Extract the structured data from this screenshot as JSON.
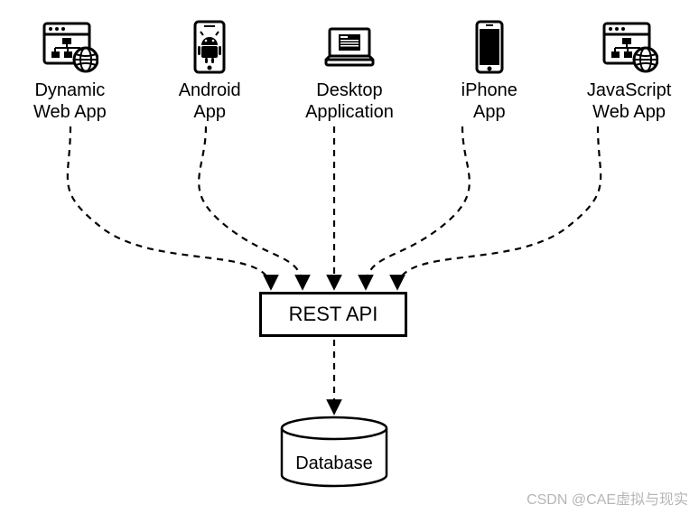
{
  "clients": [
    {
      "id": "dynamic-web-app",
      "label": "Dynamic\nWeb App",
      "icon": "browser-sitemap-globe"
    },
    {
      "id": "android-app",
      "label": "Android\nApp",
      "icon": "android-phone"
    },
    {
      "id": "desktop-app",
      "label": "Desktop\nApplication",
      "icon": "laptop-app"
    },
    {
      "id": "iphone-app",
      "label": "iPhone\nApp",
      "icon": "iphone"
    },
    {
      "id": "javascript-web-app",
      "label": "JavaScript\nWeb App",
      "icon": "browser-sitemap-globe"
    }
  ],
  "rest_api": {
    "label": "REST API"
  },
  "database": {
    "label": "Database"
  },
  "watermark": "CSDN @CAE虚拟与现实",
  "chart_data": {
    "type": "diagram",
    "title": "",
    "nodes": [
      {
        "id": "dynamic-web-app",
        "label": "Dynamic Web App",
        "kind": "client"
      },
      {
        "id": "android-app",
        "label": "Android App",
        "kind": "client"
      },
      {
        "id": "desktop-app",
        "label": "Desktop Application",
        "kind": "client"
      },
      {
        "id": "iphone-app",
        "label": "iPhone App",
        "kind": "client"
      },
      {
        "id": "javascript-web-app",
        "label": "JavaScript Web App",
        "kind": "client"
      },
      {
        "id": "rest-api",
        "label": "REST API",
        "kind": "service"
      },
      {
        "id": "database",
        "label": "Database",
        "kind": "datastore"
      }
    ],
    "edges": [
      {
        "from": "dynamic-web-app",
        "to": "rest-api",
        "style": "dashed",
        "arrow": "to"
      },
      {
        "from": "android-app",
        "to": "rest-api",
        "style": "dashed",
        "arrow": "to"
      },
      {
        "from": "desktop-app",
        "to": "rest-api",
        "style": "dashed",
        "arrow": "to"
      },
      {
        "from": "iphone-app",
        "to": "rest-api",
        "style": "dashed",
        "arrow": "to"
      },
      {
        "from": "javascript-web-app",
        "to": "rest-api",
        "style": "dashed",
        "arrow": "to"
      },
      {
        "from": "rest-api",
        "to": "database",
        "style": "dashed",
        "arrow": "to"
      }
    ]
  }
}
